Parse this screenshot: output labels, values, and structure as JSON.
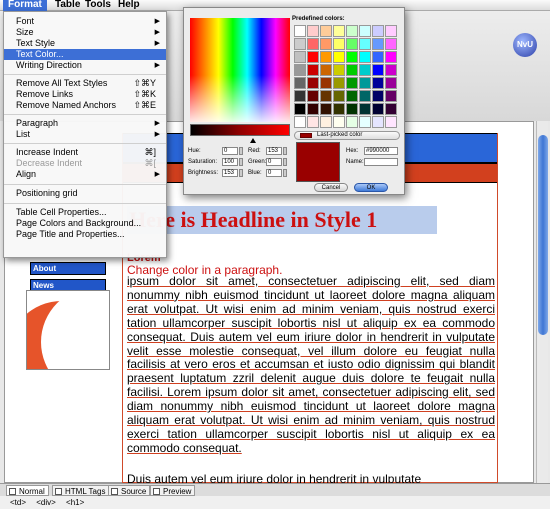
{
  "menubar": {
    "items": [
      "Format",
      "Table",
      "Tools",
      "Help"
    ],
    "active": "Format"
  },
  "format_menu": {
    "items": [
      {
        "label": "Font",
        "submenu": true
      },
      {
        "label": "Size",
        "submenu": true
      },
      {
        "label": "Text Style",
        "submenu": true
      },
      {
        "label": "Text Color...",
        "selected": true
      },
      {
        "label": "Writing Direction",
        "submenu": true
      },
      {
        "label": "Remove All Text Styles",
        "shortcut": "⇧⌘Y"
      },
      {
        "label": "Remove Links",
        "shortcut": "⇧⌘K"
      },
      {
        "label": "Remove Named Anchors",
        "shortcut": "⇧⌘E"
      },
      {
        "label": "Paragraph",
        "submenu": true
      },
      {
        "label": "List",
        "submenu": true
      },
      {
        "label": "Increase Indent",
        "shortcut": "⌘]"
      },
      {
        "label": "Decrease Indent",
        "shortcut": "⌘[",
        "disabled": true
      },
      {
        "label": "Align",
        "submenu": true
      },
      {
        "label": "Positioning grid"
      },
      {
        "label": "Table Cell Properties..."
      },
      {
        "label": "Page Colors and Background..."
      },
      {
        "label": "Page Title and Properties..."
      }
    ]
  },
  "color_dialog": {
    "predefined_label": "Predefined colors:",
    "last_picked_label": "Last-picked color",
    "fields": {
      "hue": {
        "label": "Hue:",
        "value": "0"
      },
      "saturation": {
        "label": "Saturation:",
        "value": "100"
      },
      "brightness": {
        "label": "Brightness:",
        "value": "153"
      },
      "red": {
        "label": "Red:",
        "value": "153"
      },
      "green": {
        "label": "Green:",
        "value": "0"
      },
      "blue": {
        "label": "Blue:",
        "value": "0"
      },
      "hex": {
        "label": "Hex:",
        "value": "#990000"
      },
      "name": {
        "label": "Name:",
        "value": ""
      }
    },
    "current_color": "#990000",
    "cancel_label": "Cancel",
    "ok_label": "OK",
    "palette": [
      "#ffffff",
      "#ffcccc",
      "#ffcc99",
      "#ffff99",
      "#ccffcc",
      "#ccffff",
      "#ccccff",
      "#ffccff",
      "#cccccc",
      "#ff6666",
      "#ff9966",
      "#ffff66",
      "#66ff66",
      "#66ffff",
      "#6699ff",
      "#ff66ff",
      "#c0c0c0",
      "#ff0000",
      "#ff9900",
      "#ffff00",
      "#00ff00",
      "#00ffff",
      "#3366ff",
      "#ff00ff",
      "#999999",
      "#cc0000",
      "#cc6600",
      "#cccc00",
      "#00cc00",
      "#00cccc",
      "#0000ff",
      "#cc00cc",
      "#666666",
      "#990000",
      "#993300",
      "#999900",
      "#009900",
      "#009999",
      "#000099",
      "#990099",
      "#333333",
      "#660000",
      "#663300",
      "#666600",
      "#006600",
      "#006666",
      "#000066",
      "#660066",
      "#000000",
      "#330000",
      "#331100",
      "#333300",
      "#003300",
      "#003333",
      "#000033",
      "#330033",
      "#ffffff",
      "#ffe5e5",
      "#fff0e0",
      "#fffff0",
      "#e5ffe5",
      "#e5ffff",
      "#e5e5ff",
      "#ffe5ff"
    ]
  },
  "document": {
    "headline": "Here is Headline in Style 1",
    "subheading": "Lorem",
    "change_color": "Change color in a paragraph.",
    "nav": [
      "About",
      "News"
    ],
    "body": "ipsum dolor sit amet, consectetuer adipiscing elit, sed diam nonummy nibh euismod tincidunt ut laoreet dolore magna aliquam erat volutpat. Ut wisi enim ad minim veniam, quis nostrud exerci tation ullamcorper suscipit lobortis nisl ut aliquip ex ea commodo consequat. Duis autem vel eum iriure dolor in hendrerit in vulputate velit esse molestie consequat, vel illum dolore eu feugiat nulla facilisis at vero eros et accumsan et iusto odio dignissim qui blandit praesent luptatum zzril delenit augue duis dolore te feugait nulla facilisi. Lorem ipsum dolor sit amet, consectetuer adipiscing elit, sed diam nonummy nibh euismod tincidunt ut laoreet dolore magna aliquam erat volutpat. Ut wisi enim ad minim veniam, quis nostrud exerci tation ullamcorper suscipit lobortis nisl ut aliquip ex ea commodo consequat.",
    "body2": "Duis autem vel eum iriure dolor in hendrerit in vulputate"
  },
  "view_tabs": [
    "Normal",
    "HTML Tags",
    "Source",
    "Preview"
  ],
  "tag_path": "<td>  <div>  <h1>",
  "badge_text": "NvU"
}
